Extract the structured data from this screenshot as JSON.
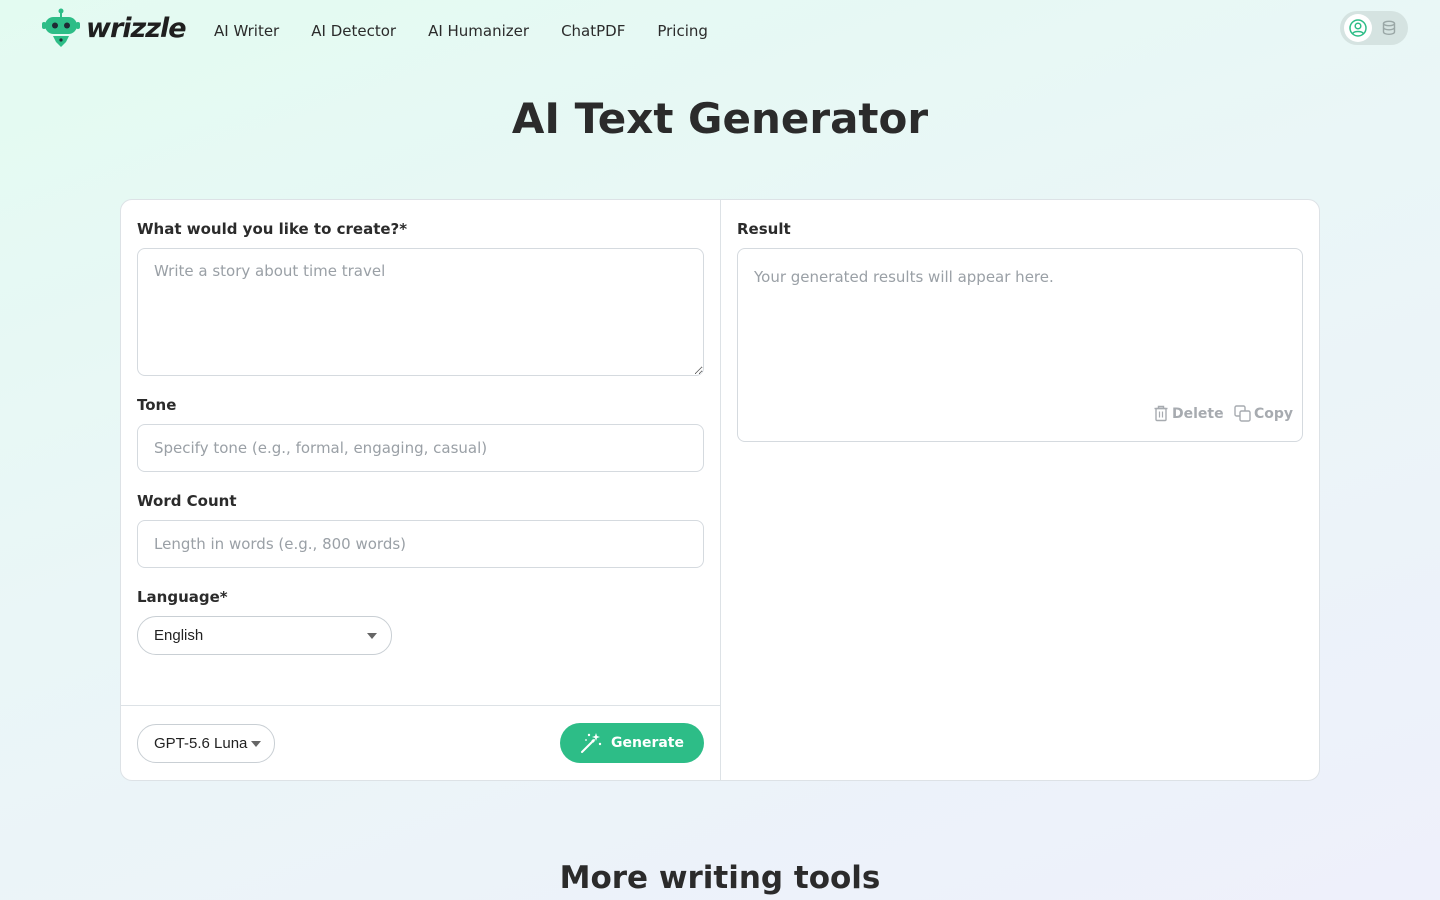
{
  "brand": {
    "name": "wrizzle",
    "accent": "#2dbd87"
  },
  "nav": [
    {
      "label": "AI Writer"
    },
    {
      "label": "AI Detector"
    },
    {
      "label": "AI Humanizer"
    },
    {
      "label": "ChatPDF"
    },
    {
      "label": "Pricing"
    }
  ],
  "user": {
    "avatar_icon": "user-icon",
    "credits_icon": "coins-icon"
  },
  "page": {
    "title": "AI Text Generator"
  },
  "form": {
    "prompt_label": "What would you like to create?*",
    "prompt_placeholder": "Write a story about time travel",
    "tone_label": "Tone",
    "tone_placeholder": "Specify tone (e.g., formal, engaging, casual)",
    "word_count_label": "Word Count",
    "word_count_placeholder": "Length in words (e.g., 800 words)",
    "language_label": "Language*",
    "language_value": "English",
    "model_value": "GPT-5.6 Luna",
    "generate_label": "Generate"
  },
  "result": {
    "label": "Result",
    "placeholder": "Your generated results will appear here.",
    "delete_label": "Delete",
    "copy_label": "Copy"
  },
  "more": {
    "title": "More writing tools"
  }
}
